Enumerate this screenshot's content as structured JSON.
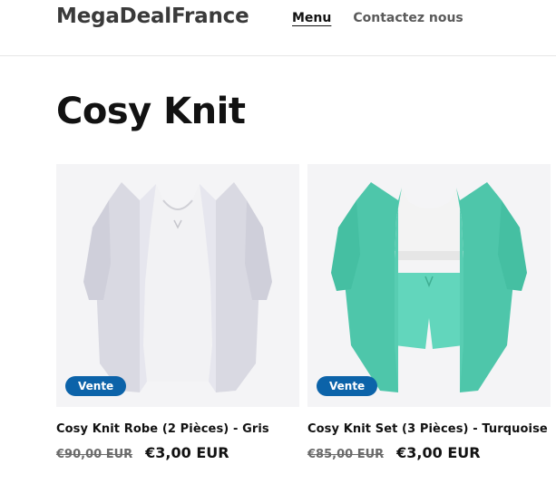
{
  "header": {
    "logo": "MegaDealFrance",
    "nav": [
      {
        "label": "Menu",
        "active": true
      },
      {
        "label": "Contactez nous",
        "active": false
      }
    ]
  },
  "collection": {
    "title": "Cosy Knit"
  },
  "products": [
    {
      "title": "Cosy Knit Robe (2 Pièces) - Gris",
      "badge": "Vente",
      "price_old": "€90,00 EUR",
      "price_new": "€3,00 EUR",
      "image": "grey-knit-dress-cardigan",
      "color": "#e3e3ea"
    },
    {
      "title": "Cosy Knit Set (3 Pièces) - Turquoise",
      "badge": "Vente",
      "price_old": "€85,00 EUR",
      "price_new": "€3,00 EUR",
      "image": "turquoise-knit-set",
      "color": "#5fd3b8"
    }
  ],
  "colors": {
    "badge": "#0c63a9",
    "text": "#121212"
  }
}
